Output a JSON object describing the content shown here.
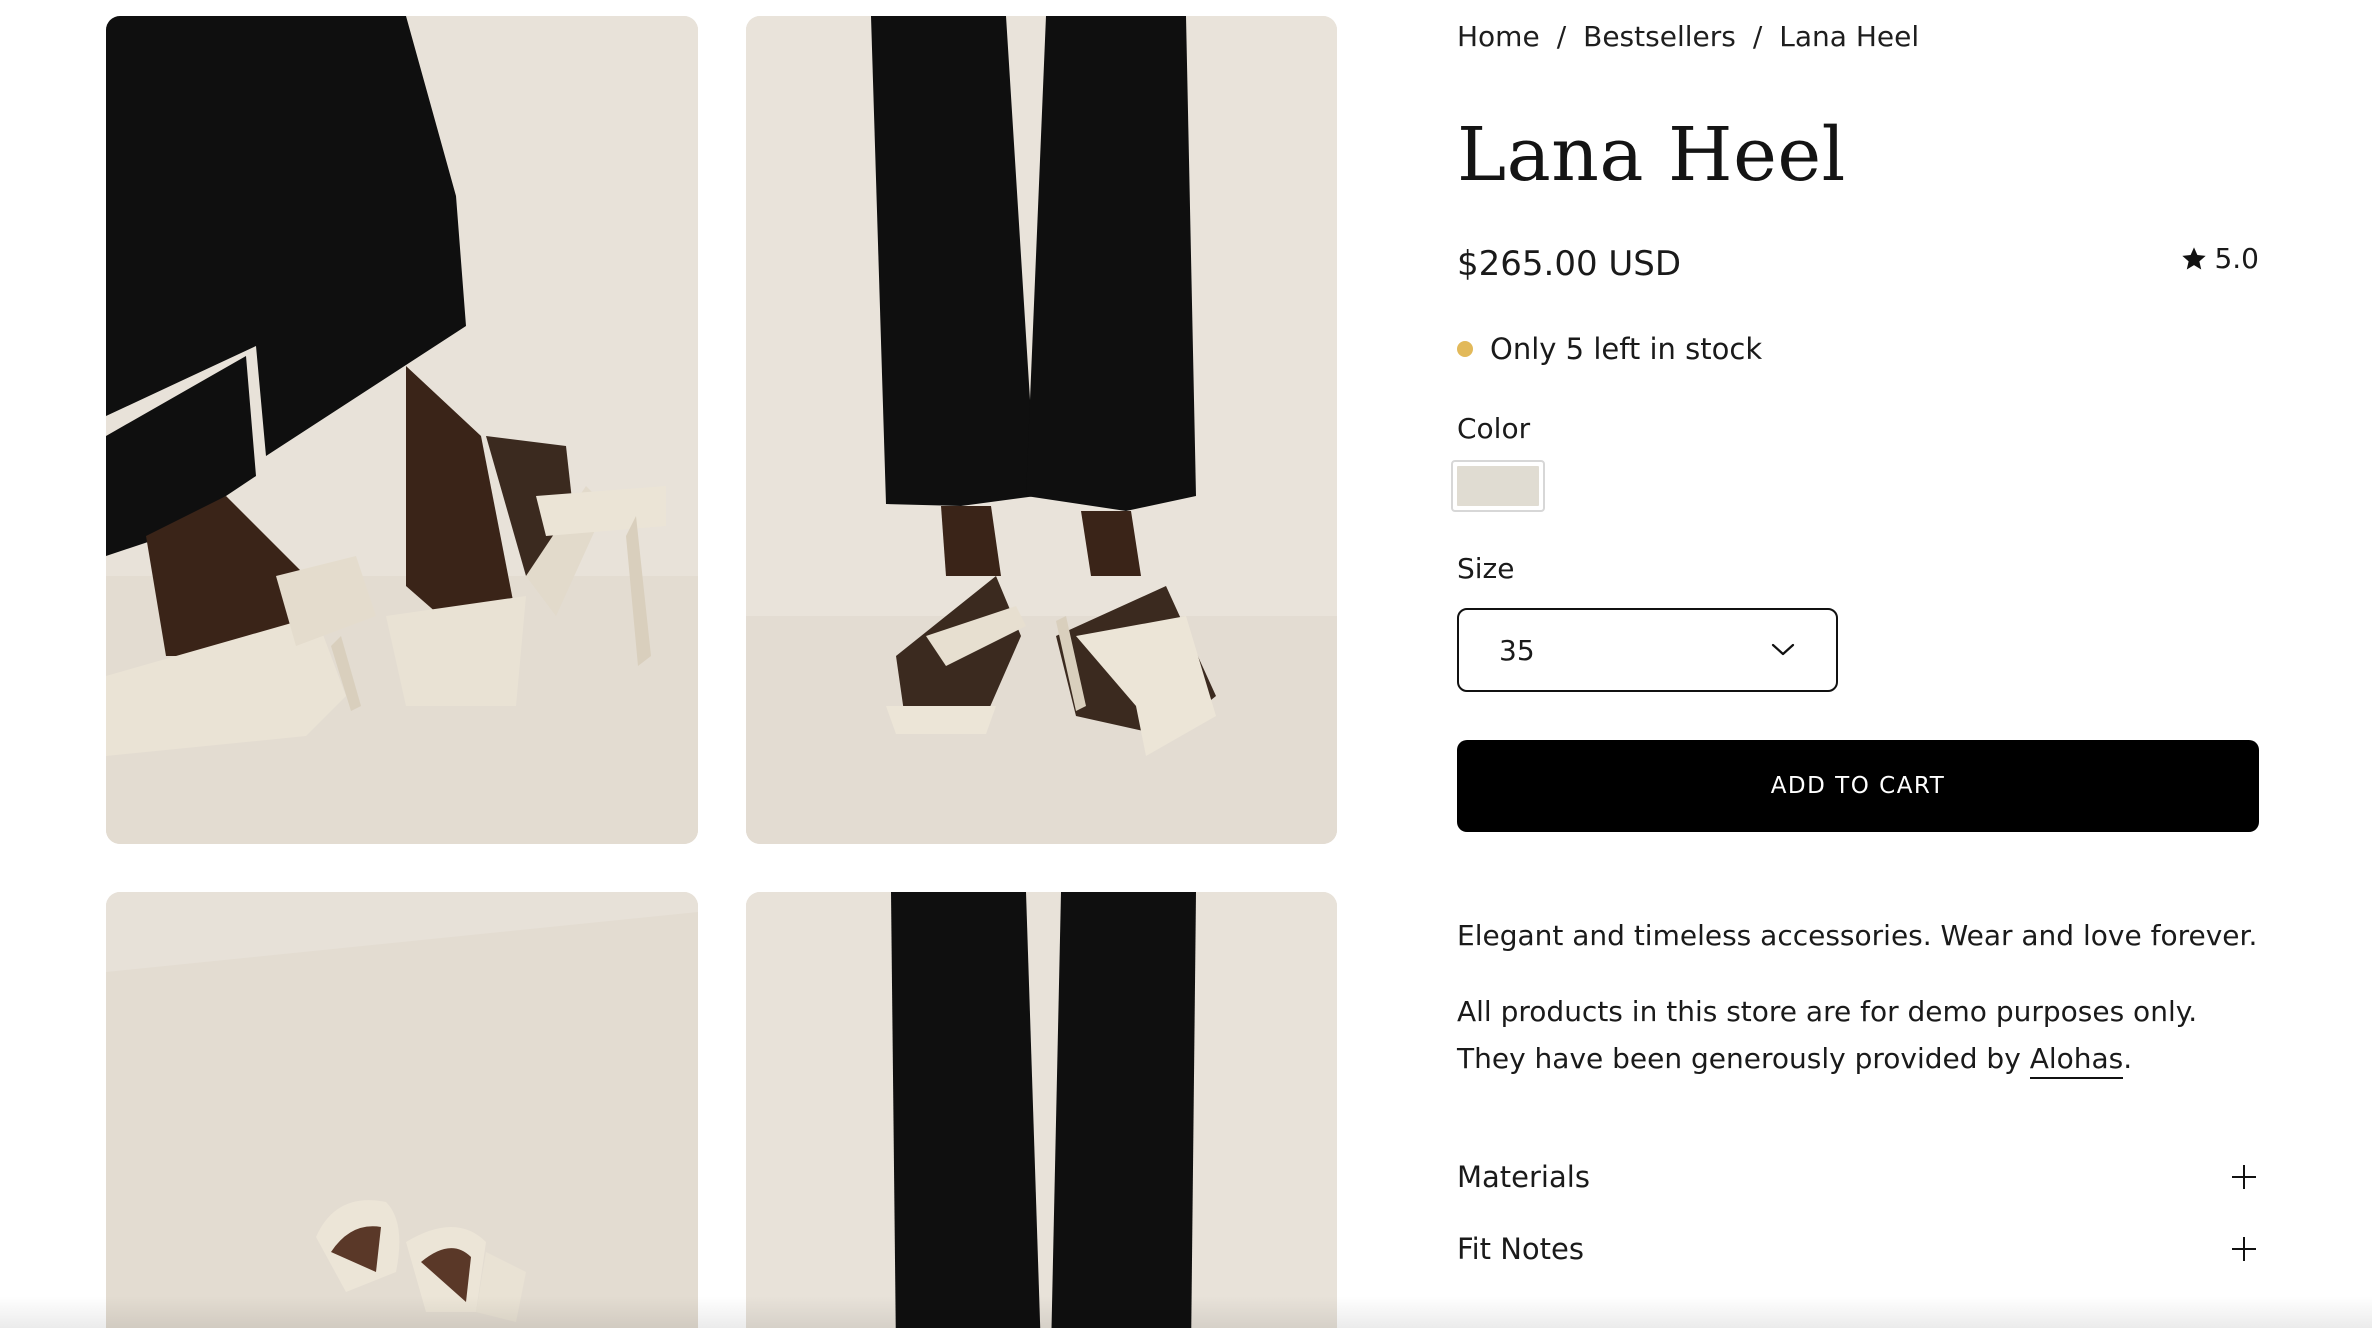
{
  "breadcrumb": {
    "items": [
      "Home",
      "Bestsellers",
      "Lana Heel"
    ],
    "separator": "/"
  },
  "product": {
    "title": "Lana Heel",
    "price": "$265.00 USD",
    "rating": "5.0",
    "stock_text": "Only 5 left in stock",
    "stock_dot_color": "#e2b95a",
    "color_label": "Color",
    "selected_swatch_color": "#e0dcd2",
    "size_label": "Size",
    "selected_size": "35",
    "add_to_cart": "ADD TO CART"
  },
  "description": {
    "line1": "Elegant and timeless accessories. Wear and love forever.",
    "line2": "All products in this store are for demo purposes only.",
    "line3_prefix": "They have been generously provided by ",
    "link_text": "Alohas",
    "line3_suffix": "."
  },
  "accordions": [
    {
      "label": "Materials"
    },
    {
      "label": "Fit Notes"
    }
  ],
  "icons": {
    "rating": "star-icon",
    "size_select": "chevron-down-icon",
    "accordion": "plus-icon"
  },
  "colors": {
    "background": "#ffffff",
    "button": "#000000",
    "button_text": "#ffffff",
    "photo_backdrop": "#e6dfd6",
    "pants": "#0f0f0f",
    "sandal": "#ece6da"
  }
}
